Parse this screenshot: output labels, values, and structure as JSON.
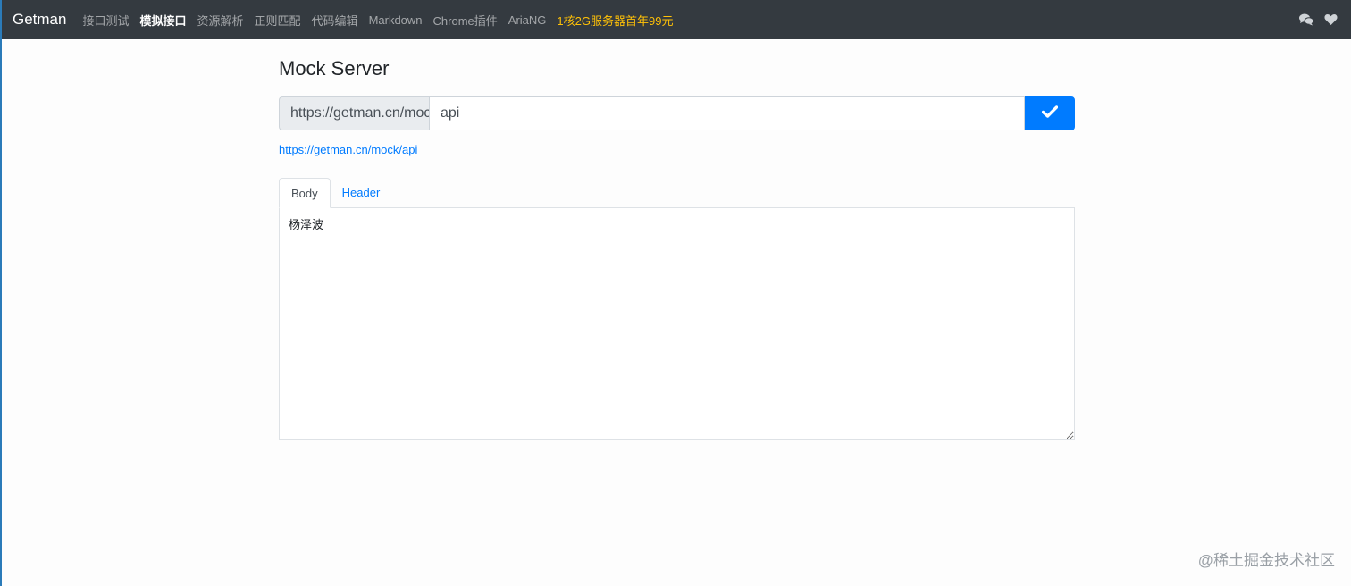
{
  "navbar": {
    "brand": "Getman",
    "links": [
      {
        "label": "接口测试",
        "active": false
      },
      {
        "label": "模拟接口",
        "active": true
      },
      {
        "label": "资源解析",
        "active": false
      },
      {
        "label": "正则匹配",
        "active": false
      },
      {
        "label": "代码编辑",
        "active": false
      },
      {
        "label": "Markdown",
        "active": false
      },
      {
        "label": "Chrome插件",
        "active": false
      },
      {
        "label": "AriaNG",
        "active": false
      }
    ],
    "promo": "1核2G服务器首年99元",
    "icons": [
      "comments-icon",
      "heart-icon"
    ]
  },
  "main": {
    "title": "Mock Server",
    "url_prefix": "https://getman.cn/mock",
    "path_value": "api",
    "submit_icon": "check-icon",
    "mock_url": "https://getman.cn/mock/api",
    "tabs": [
      {
        "label": "Body",
        "active": true
      },
      {
        "label": "Header",
        "active": false
      }
    ],
    "body_value": "杨泽波"
  },
  "watermark": "@稀土掘金技术社区",
  "colors": {
    "navbar_bg": "#343a40",
    "primary": "#007bff",
    "promo": "#ffc107"
  }
}
